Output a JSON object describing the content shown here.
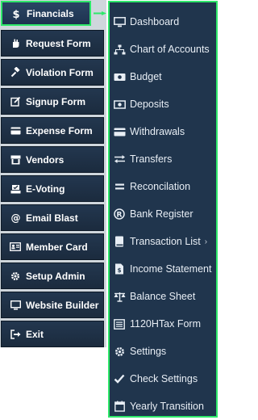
{
  "colors": {
    "highlight": "#2ee86a",
    "menu_bg": "#20354d",
    "nav_bg": "#1b2b3e"
  },
  "nav": {
    "items": [
      {
        "label": "Financials",
        "icon": "dollar-icon"
      },
      {
        "label": "Request Form",
        "icon": "hand-icon"
      },
      {
        "label": "Violation Form",
        "icon": "gavel-icon"
      },
      {
        "label": "Signup Form",
        "icon": "edit-icon"
      },
      {
        "label": "Expense Form",
        "icon": "credit-card-icon"
      },
      {
        "label": "Vendors",
        "icon": "store-icon"
      },
      {
        "label": "E-Voting",
        "icon": "vote-icon"
      },
      {
        "label": "Email Blast",
        "icon": "at-icon"
      },
      {
        "label": "Member Card",
        "icon": "id-card-icon"
      },
      {
        "label": "Setup Admin",
        "icon": "gear-icon"
      },
      {
        "label": "Website Builder",
        "icon": "monitor-icon"
      },
      {
        "label": "Exit",
        "icon": "sign-out-icon"
      }
    ]
  },
  "submenu": {
    "items": [
      {
        "label": "Dashboard",
        "icon": "monitor-icon"
      },
      {
        "label": "Chart of Accounts",
        "icon": "sitemap-icon"
      },
      {
        "label": "Budget",
        "icon": "money-icon"
      },
      {
        "label": "Deposits",
        "icon": "money-bill-icon"
      },
      {
        "label": "Withdrawals",
        "icon": "credit-card-icon"
      },
      {
        "label": "Transfers",
        "icon": "exchange-icon"
      },
      {
        "label": "Reconcilation",
        "icon": "equals-icon"
      },
      {
        "label": "Bank Register",
        "icon": "registered-icon"
      },
      {
        "label": "Transaction List",
        "icon": "book-icon",
        "chevron": "›"
      },
      {
        "label": "Income Statement",
        "icon": "file-invoice-icon"
      },
      {
        "label": "Balance Sheet",
        "icon": "scale-icon"
      },
      {
        "label": "1120HTax Form",
        "icon": "list-icon"
      },
      {
        "label": "Settings",
        "icon": "gear-icon"
      },
      {
        "label": "Check Settings",
        "icon": "check-icon"
      },
      {
        "label": "Yearly Transition",
        "icon": "calendar-icon"
      }
    ]
  }
}
